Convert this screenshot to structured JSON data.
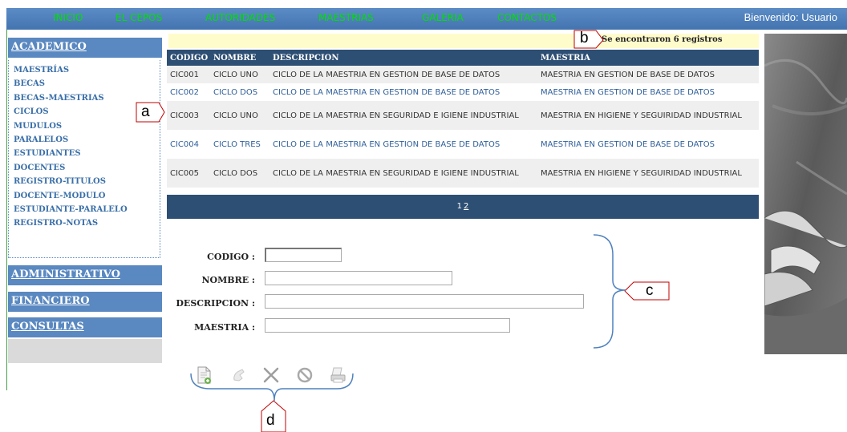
{
  "topnav": {
    "items": [
      "INICIO",
      "EL CEPOS",
      "AUTORIDADES",
      "MAESTRIAS",
      "GALERIA",
      "CONTACTOS"
    ],
    "welcome": "Bienvenido: Usuario"
  },
  "sidebar": {
    "academico": "ACADEMICO",
    "items": [
      "MAESTRÍAS",
      "BECAS",
      "BECAS-MAESTRIAS",
      "CICLOS",
      "MUDULOS",
      "PARALELOS",
      "ESTUDIANTES",
      "DOCENTES",
      "REGISTRO-TITULOS",
      "DOCENTE-MODULO",
      "ESTUDIANTE-PARALELO",
      "REGISTRO-NOTAS"
    ],
    "administrativo": "ADMINISTRATIVO",
    "financiero": "FINANCIERO",
    "consultas": "CONSULTAS"
  },
  "results": {
    "count_text": "Se encontraron 6 registros"
  },
  "table": {
    "headers": [
      "CODIGO",
      "NOMBRE",
      "DESCRIPCION",
      "MAESTRIA"
    ],
    "rows": [
      [
        "CIC001",
        "CICLO UNO",
        "CICLO DE LA MAESTRIA EN GESTION DE BASE DE DATOS",
        "MAESTRIA EN GESTION DE BASE DE DATOS"
      ],
      [
        "CIC002",
        "CICLO DOS",
        "CICLO DE LA MAESTRIA EN GESTION DE BASE DE DATOS",
        "MAESTRIA EN GESTION DE BASE DE DATOS"
      ],
      [
        "CIC003",
        "CICLO UNO",
        "CICLO DE LA MAESTRIA EN SEGURIDAD E IGIENE INDUSTRIAL",
        "MAESTRIA EN HIGIENE Y SEGUIRIDAD INDUSTRIAL"
      ],
      [
        "CIC004",
        "CICLO TRES",
        "CICLO DE LA MAESTRIA EN GESTION DE BASE DE DATOS",
        "MAESTRIA EN GESTION DE BASE DE DATOS"
      ],
      [
        "CIC005",
        "CICLO DOS",
        "CICLO DE LA MAESTRIA EN SEGURIDAD E IGIENE INDUSTRIAL",
        "MAESTRIA EN HIGIENE Y SEGUIRIDAD INDUSTRIAL"
      ]
    ],
    "pages": [
      "1",
      "2"
    ]
  },
  "form": {
    "codigo_label": "CODIGO :",
    "nombre_label": "NOMBRE :",
    "descripcion_label": "DESCRIPCION :",
    "maestria_label": "MAESTRIA :",
    "codigo_value": "",
    "nombre_value": "",
    "descripcion_value": "",
    "maestria_value": ""
  },
  "toolbar": {
    "icons": [
      "new-record-icon",
      "edit-icon",
      "delete-icon",
      "cancel-icon",
      "print-icon"
    ]
  },
  "annotations": {
    "a": "a",
    "b": "b",
    "c": "c",
    "d": "d",
    "color": "#c00000",
    "bracket_color": "#4f81bd"
  },
  "colors": {
    "nav_bg": "#4f81bd",
    "nav_text": "#00e000",
    "table_header": "#2e4f74",
    "link": "#2f5f9a",
    "result_bar": "#fffccc"
  }
}
